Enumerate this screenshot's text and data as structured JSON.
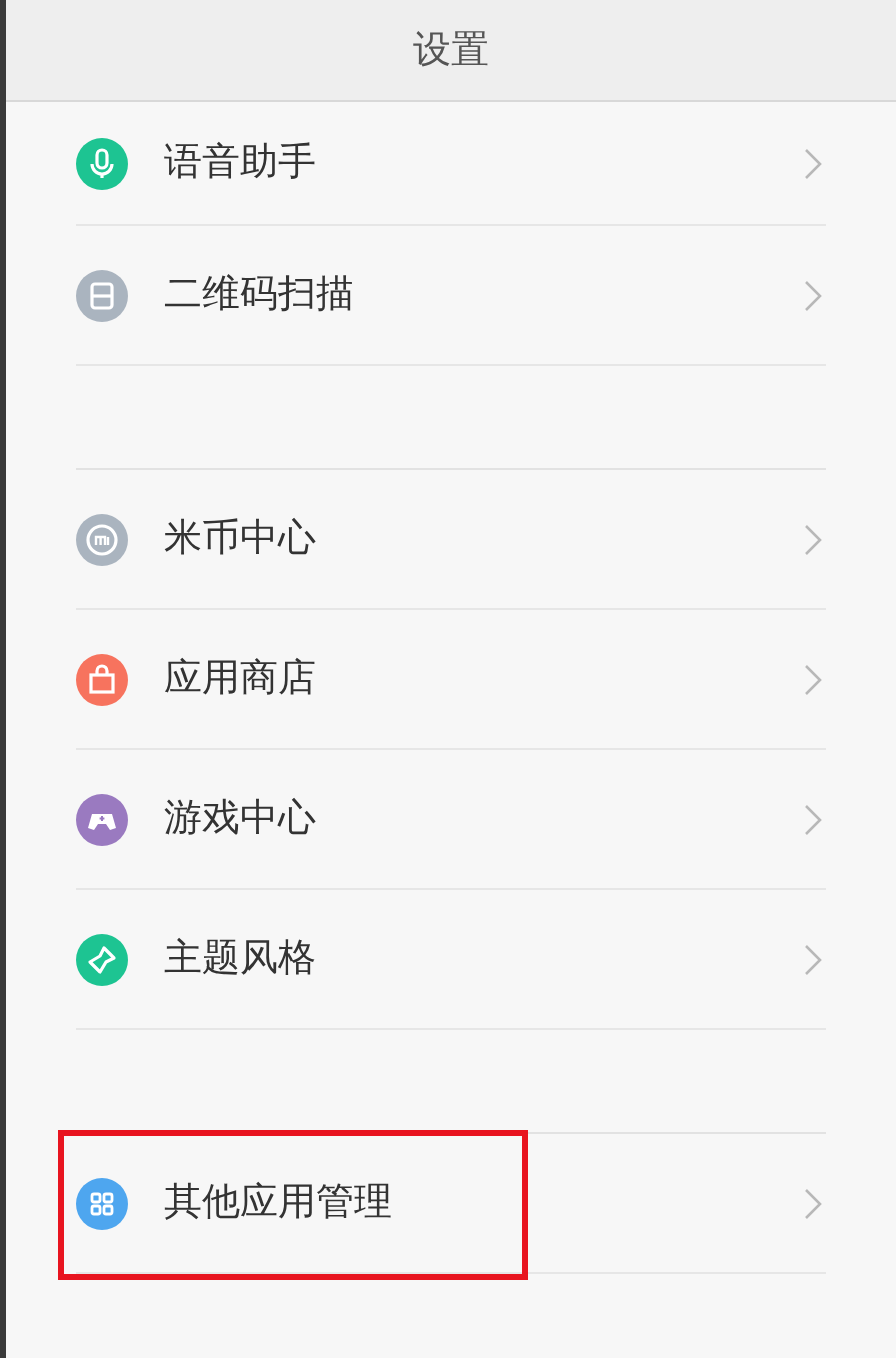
{
  "header": {
    "title": "设置"
  },
  "sections": [
    {
      "items": [
        {
          "label": "语音助手",
          "kind": "mic",
          "color": "#1dc492",
          "highlighted": false
        },
        {
          "label": "二维码扫描",
          "kind": "scan",
          "color": "#aab4bf",
          "highlighted": false
        }
      ]
    },
    {
      "items": [
        {
          "label": "米币中心",
          "kind": "coin",
          "color": "#aab4bf",
          "highlighted": false
        },
        {
          "label": "应用商店",
          "kind": "bag",
          "color": "#f7735e",
          "highlighted": false
        },
        {
          "label": "游戏中心",
          "kind": "gamepad",
          "color": "#9a7ac0",
          "highlighted": false
        },
        {
          "label": "主题风格",
          "kind": "brush",
          "color": "#1dc492",
          "highlighted": false
        }
      ]
    },
    {
      "items": [
        {
          "label": "其他应用管理",
          "kind": "grid",
          "color": "#4ea6ef",
          "highlighted": true
        }
      ]
    }
  ]
}
